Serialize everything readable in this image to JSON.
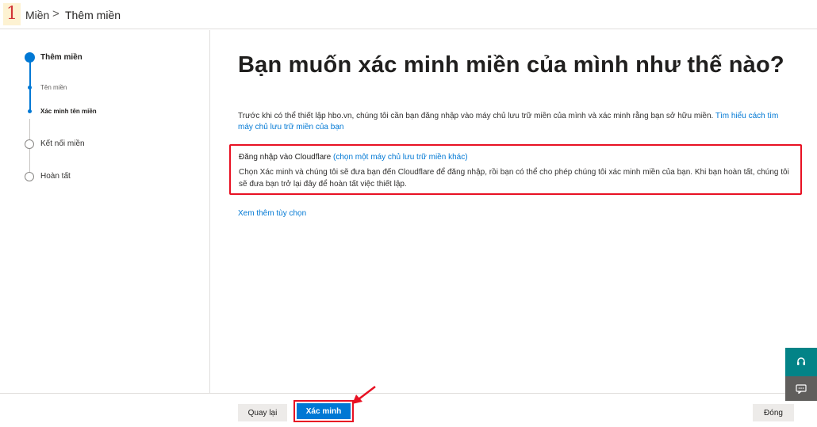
{
  "annotation": {
    "step_number": "1"
  },
  "breadcrumb": {
    "root": "Miền",
    "separator": ">",
    "current": "Thêm miền"
  },
  "wizard": {
    "steps": [
      {
        "label": "Thêm miền",
        "state": "current-parent"
      },
      {
        "label": "Tên miền",
        "state": "done-substep"
      },
      {
        "label": "Xác minh tên miền",
        "state": "current-substep"
      },
      {
        "label": "Kết nối miền",
        "state": "pending"
      },
      {
        "label": "Hoàn tất",
        "state": "pending"
      }
    ]
  },
  "main": {
    "title": "Bạn muốn xác minh miền của mình như thế nào?",
    "intro_text": "Trước khi có thể thiết lập hbo.vn, chúng tôi cần bạn đăng nhập vào máy chủ lưu trữ miền của mình và xác minh rằng bạn sở hữu miền. ",
    "intro_link": "Tìm hiểu cách tìm máy chủ lưu trữ miền của bạn",
    "provider": {
      "title": "Đăng nhập vào Cloudflare",
      "change_link": "(chọn một máy chủ lưu trữ miền khác)",
      "description": "Chọn Xác minh và chúng tôi sẽ đưa bạn đến Cloudflare để đăng nhập, rồi bạn có thể cho phép chúng tôi xác minh miền của bạn. Khi bạn hoàn tất, chúng tôi sẽ đưa bạn trở lại đây để hoàn tất việc thiết lập."
    },
    "more_options_link": "Xem thêm tùy chọn"
  },
  "footer": {
    "back_label": "Quay lại",
    "verify_label": "Xác minh",
    "close_label": "Đóng"
  },
  "colors": {
    "accent": "#0078d4",
    "highlight_border": "#e81123",
    "support_fab": "#038387",
    "feedback_fab": "#605e5c"
  },
  "icons": {
    "breadcrumb_separator": "chevron-right-icon",
    "support": "headset-icon",
    "feedback": "chat-icon"
  }
}
